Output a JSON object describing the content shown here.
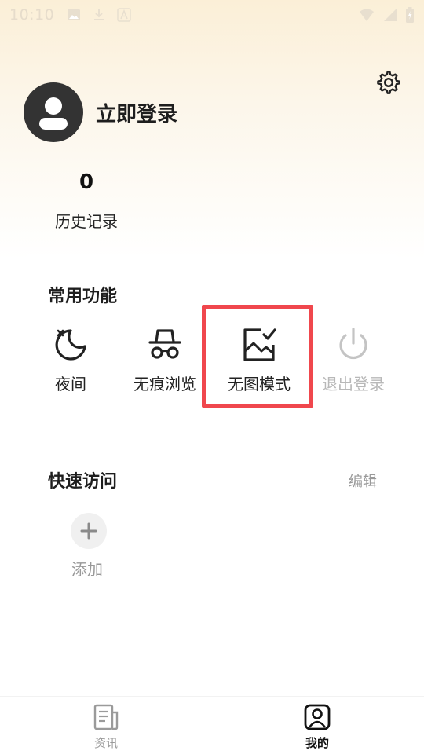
{
  "status_bar": {
    "time": "10:10",
    "icons_left": [
      "image-icon",
      "download-icon",
      "font-icon"
    ],
    "icons_right": [
      "wifi-icon",
      "signal-icon",
      "battery-charging-icon"
    ]
  },
  "profile": {
    "login_label": "立即登录"
  },
  "history": {
    "count": "0",
    "label": "历史记录"
  },
  "functions": {
    "title": "常用功能",
    "items": [
      {
        "label": "夜间",
        "icon": "moon-icon"
      },
      {
        "label": "无痕浏览",
        "icon": "incognito-icon"
      },
      {
        "label": "无图模式",
        "icon": "no-image-icon"
      },
      {
        "label": "退出登录",
        "icon": "power-icon"
      }
    ]
  },
  "quick_access": {
    "title": "快速访问",
    "edit_label": "编辑",
    "add_label": "添加"
  },
  "bottom_nav": {
    "items": [
      {
        "label": "资讯",
        "icon": "news-icon",
        "active": false
      },
      {
        "label": "我的",
        "icon": "profile-icon",
        "active": true
      }
    ]
  },
  "colors": {
    "highlight": "#f0474d",
    "header_gradient": "#fbefd7",
    "disabled_text": "#b8b8b8",
    "avatar_bg": "#333333"
  }
}
